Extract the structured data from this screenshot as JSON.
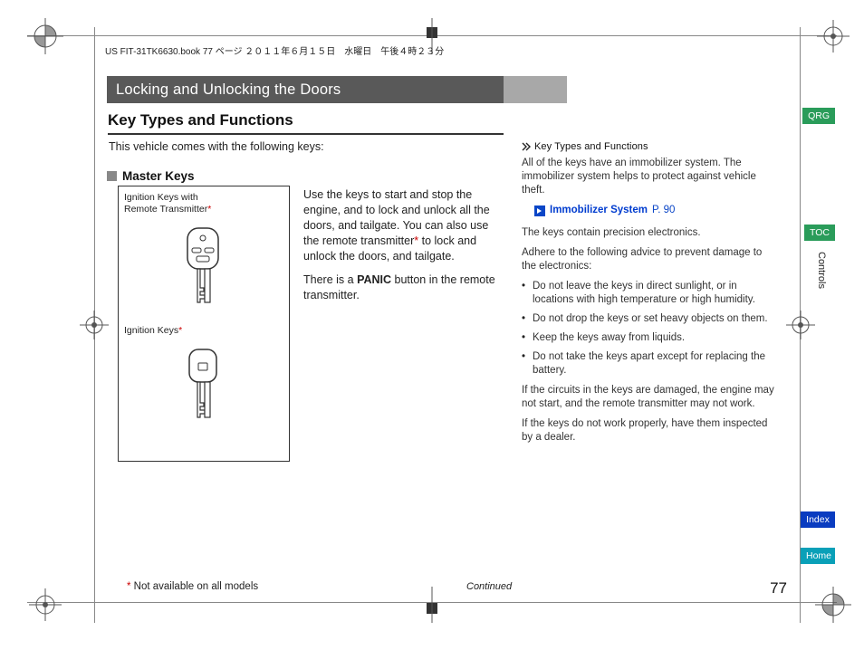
{
  "meta_header": "US FIT-31TK6630.book  77 ページ  ２０１１年６月１５日　水曜日　午後４時２３分",
  "title_bar": "Locking and Unlocking the Doors",
  "section_title": "Key Types and Functions",
  "intro_text": "This vehicle comes with the following keys:",
  "sub_heading": "Master Keys",
  "figure": {
    "label1_line1": "Ignition Keys with",
    "label1_line2": "Remote Transmitter",
    "label2": "Ignition Keys"
  },
  "body": {
    "p1": "Use the keys to start and stop the engine, and to lock and unlock all the doors, and tailgate. You can also use the remote transmitter",
    "p1b": " to lock and unlock the doors, and tailgate.",
    "p2a": "There is a ",
    "p2_bold": "PANIC",
    "p2b": " button in the remote transmitter."
  },
  "sidebar": {
    "heading": "Key Types and Functions",
    "p1": "All of the keys have an immobilizer system. The immobilizer system helps to protect against vehicle theft.",
    "link_text": "Immobilizer System",
    "link_page": "P. 90",
    "p2": "The keys contain precision electronics.",
    "p3": "Adhere to the following advice to prevent damage to the electronics:",
    "bullets": [
      "Do not leave the keys in direct sunlight, or in locations with high temperature or high humidity.",
      "Do not drop the keys or set heavy objects on them.",
      "Keep the keys away from liquids.",
      "Do not take the keys apart except for replacing the battery."
    ],
    "p4": "If the circuits in the keys are damaged, the engine may not start, and the remote transmitter may not work.",
    "p5": "If the keys do not work properly, have them inspected by a dealer."
  },
  "footnote": " Not available on all models",
  "continued": "Continued",
  "page_number": "77",
  "tabs": {
    "qrg": "QRG",
    "toc": "TOC",
    "index": "Index",
    "home": "Home"
  },
  "side_label": "Controls"
}
